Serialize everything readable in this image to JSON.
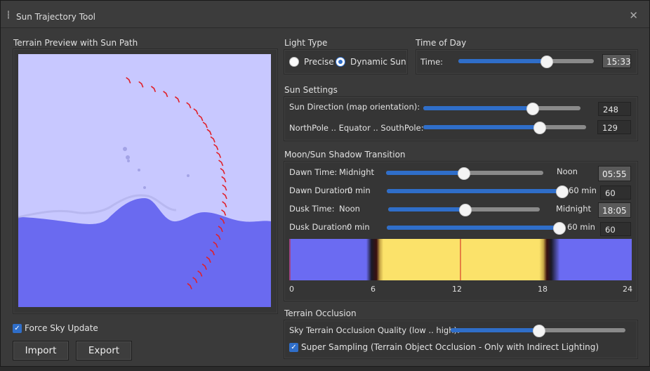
{
  "window": {
    "title": "Sun Trajectory Tool"
  },
  "preview": {
    "label": "Terrain Preview with Sun Path"
  },
  "force_sky": {
    "label": "Force Sky Update",
    "checked": true
  },
  "buttons": {
    "import": "Import",
    "export": "Export"
  },
  "light_type": {
    "label": "Light Type",
    "options": [
      "Precise",
      "Dynamic Sun"
    ],
    "selected": "Dynamic Sun"
  },
  "time_of_day": {
    "label": "Time of Day",
    "time_label": "Time:",
    "value": "15:33",
    "slider": 0.647
  },
  "sun_settings": {
    "label": "Sun Settings",
    "direction_label": "Sun Direction (map orientation):",
    "direction_value": "248",
    "direction_slider": 0.69,
    "pole_label": "NorthPole .. Equator .. SouthPole:",
    "pole_value": "129",
    "pole_slider": 0.71
  },
  "transition": {
    "label": "Moon/Sun Shadow Transition",
    "dawn_time_label": "Dawn Time:",
    "dawn_left": "Midnight",
    "dawn_right": "Noon",
    "dawn_value": "05:55",
    "dawn_slider": 0.49,
    "dawn_duration_label": "Dawn Duration:",
    "dawn_dur_left": "0 min",
    "dawn_dur_right": "60 min",
    "dawn_dur_value": "60",
    "dawn_dur_slider": 1.0,
    "dusk_time_label": "Dusk Time:",
    "dusk_left": "Noon",
    "dusk_right": "Midnight",
    "dusk_value": "18:05",
    "dusk_slider": 0.505,
    "dusk_duration_label": "Dusk Duration:",
    "dusk_dur_left": "0 min",
    "dusk_dur_right": "60 min",
    "dusk_dur_value": "60",
    "dusk_dur_slider": 1.0,
    "ticks": [
      "0",
      "6",
      "12",
      "18",
      "24"
    ]
  },
  "occlusion": {
    "label": "Terrain Occlusion",
    "quality_label": "Sky Terrain Occlusion Quality (low .. high):",
    "quality_slider": 0.5,
    "supersampling_label": "Super Sampling (Terrain Object Occlusion - Only with Indirect Lighting)",
    "supersampling_checked": true
  },
  "colors": {
    "accent": "#2f6ec9",
    "sky": "#c8c8ff",
    "terrain": "#6a6af0",
    "day": "#fbe26a",
    "night": "#6b6bf2"
  }
}
